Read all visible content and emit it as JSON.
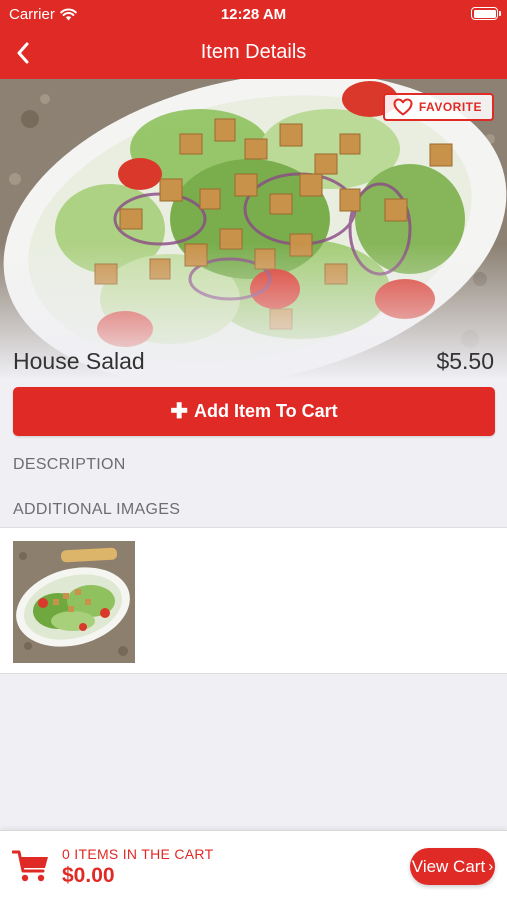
{
  "status_bar": {
    "carrier": "Carrier",
    "time": "12:28 AM",
    "wifi_icon": "wifi-icon",
    "battery_icon": "battery-icon"
  },
  "nav": {
    "title": "Item Details",
    "back_icon": "chevron-left-icon"
  },
  "item": {
    "name": "House Salad",
    "price": "$5.50",
    "favorite_label": "FAVORITE",
    "favorite_icon": "heart-outline-icon"
  },
  "add_to_cart": {
    "label": "Add Item To Cart",
    "icon": "plus-icon"
  },
  "sections": {
    "description": "DESCRIPTION",
    "additional_images": "ADDITIONAL IMAGES"
  },
  "cart": {
    "count_text": "0 ITEMS IN THE CART",
    "total": "$0.00",
    "view_cart_label": "View Cart",
    "cart_icon": "shopping-cart-icon",
    "chevron_icon": "chevron-right-icon"
  },
  "colors": {
    "brand_red": "#e02a26",
    "background": "#efeff4",
    "label_gray": "#6d6d72"
  }
}
